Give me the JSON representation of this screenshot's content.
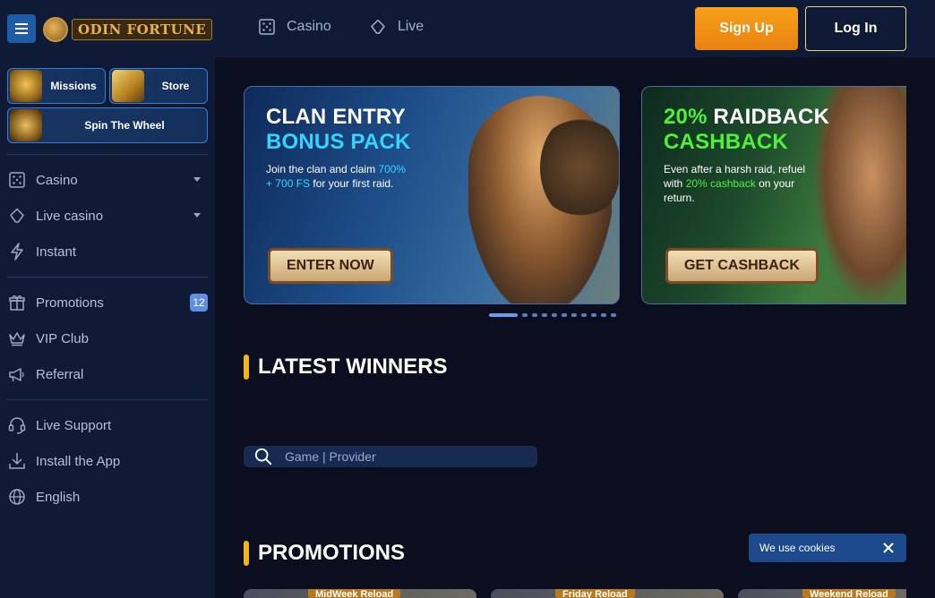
{
  "header": {
    "logo_text": "ODIN FORTUNE",
    "nav": [
      {
        "label": "Casino",
        "icon": "dice-icon"
      },
      {
        "label": "Live",
        "icon": "chip-icon"
      }
    ],
    "signup_label": "Sign Up",
    "login_label": "Log In"
  },
  "sidebar": {
    "tiles": [
      {
        "label": "Missions"
      },
      {
        "label": "Store"
      },
      {
        "label": "Spin The Wheel"
      }
    ],
    "games": [
      {
        "label": "Casino",
        "icon": "dice-icon"
      },
      {
        "label": "Live casino",
        "icon": "chip-icon"
      },
      {
        "label": "Instant",
        "icon": "lightning-icon"
      }
    ],
    "engage": [
      {
        "label": "Promotions",
        "icon": "gift-icon",
        "badge": "12"
      },
      {
        "label": "VIP Club",
        "icon": "crown-icon"
      },
      {
        "label": "Referral",
        "icon": "megaphone-icon"
      }
    ],
    "support": [
      {
        "label": "Live Support",
        "icon": "headset-icon"
      },
      {
        "label": "Install the App",
        "icon": "download-icon"
      },
      {
        "label": "English",
        "icon": "globe-icon"
      }
    ]
  },
  "banners": [
    {
      "title_line1": "CLAN ENTRY",
      "title_line2": "BONUS PACK",
      "text_before": "Join the clan and claim ",
      "text_highlight": "700% + 700 FS",
      "text_after": " for your first raid.",
      "button": "ENTER NOW"
    },
    {
      "title_line1_accent": "20%",
      "title_line1_rest": " RAIDBACK",
      "title_line2": "CASHBACK",
      "text_before": "Even after a harsh raid, refuel with ",
      "text_highlight": "20% cashback",
      "text_after": " on your return.",
      "button": "GET CASHBACK"
    }
  ],
  "carousel": {
    "count": 11,
    "active_index": 0
  },
  "latest_winners": {
    "title": "LATEST WINNERS"
  },
  "search": {
    "placeholder": "Game | Provider"
  },
  "promotions": {
    "title": "PROMOTIONS",
    "cards": [
      {
        "tag": "MidWeek Reload"
      },
      {
        "tag": "Friday Reload"
      },
      {
        "tag": "Weekend Reload"
      }
    ]
  },
  "cookie": {
    "text": "We use cookies"
  },
  "colors": {
    "accent_orange": "#f2b51d",
    "signup": "#f7a11c",
    "banner1_highlight": "#35d4ff",
    "banner2_highlight": "#4ff03c",
    "sidebar_bg": "#0e1a36",
    "page_bg": "#0a0e1f"
  }
}
